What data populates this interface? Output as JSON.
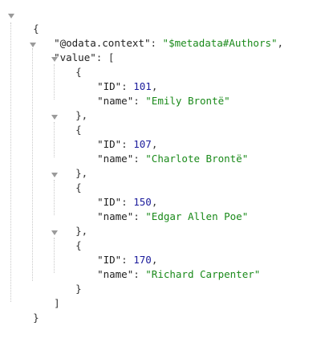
{
  "json": {
    "open_brace": "{",
    "close_brace": "}",
    "context_key": "\"@odata.context\"",
    "context_value": "\"$metadata#Authors\"",
    "value_key": "\"value\"",
    "open_bracket": "[",
    "close_bracket": "]",
    "items": [
      {
        "id_key": "\"ID\"",
        "id": "101",
        "name_key": "\"name\"",
        "name": "\"Emily Brontë\""
      },
      {
        "id_key": "\"ID\"",
        "id": "107",
        "name_key": "\"name\"",
        "name": "\"Charlote Brontë\""
      },
      {
        "id_key": "\"ID\"",
        "id": "150",
        "name_key": "\"name\"",
        "name": "\"Edgar Allen Poe\""
      },
      {
        "id_key": "\"ID\"",
        "id": "170",
        "name_key": "\"name\"",
        "name": "\"Richard Carpenter\""
      }
    ]
  },
  "colors": {
    "key": "#222222",
    "string": "#1a8a1a",
    "number": "#1c1c9c",
    "toggle": "#9a9a9a",
    "guide": "#c8c8c8"
  },
  "icons": {
    "collapse": "triangle-down-icon"
  }
}
